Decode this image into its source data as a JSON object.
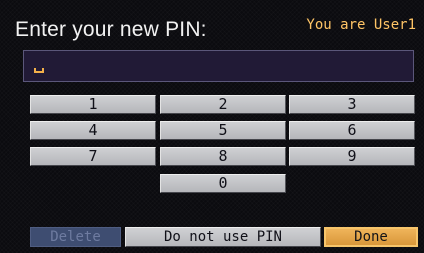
{
  "header": {
    "title": "Enter your new PIN:",
    "user_label": "You are User1"
  },
  "pin_entry": {
    "value": "",
    "cursor": "_"
  },
  "keypad": {
    "keys": [
      "1",
      "2",
      "3",
      "4",
      "5",
      "6",
      "7",
      "8",
      "9",
      "0"
    ]
  },
  "actions": {
    "delete_label": "Delete",
    "delete_enabled": false,
    "no_pin_label": "Do not use PIN",
    "done_label": "Done"
  },
  "colors": {
    "title_text": "#f2f2f2",
    "user_text": "#ffc566",
    "key_face": "#c4c5c9",
    "disabled_button": "#3e4d71",
    "done_highlight": "#e6a448",
    "field_bg": "#211a36"
  }
}
